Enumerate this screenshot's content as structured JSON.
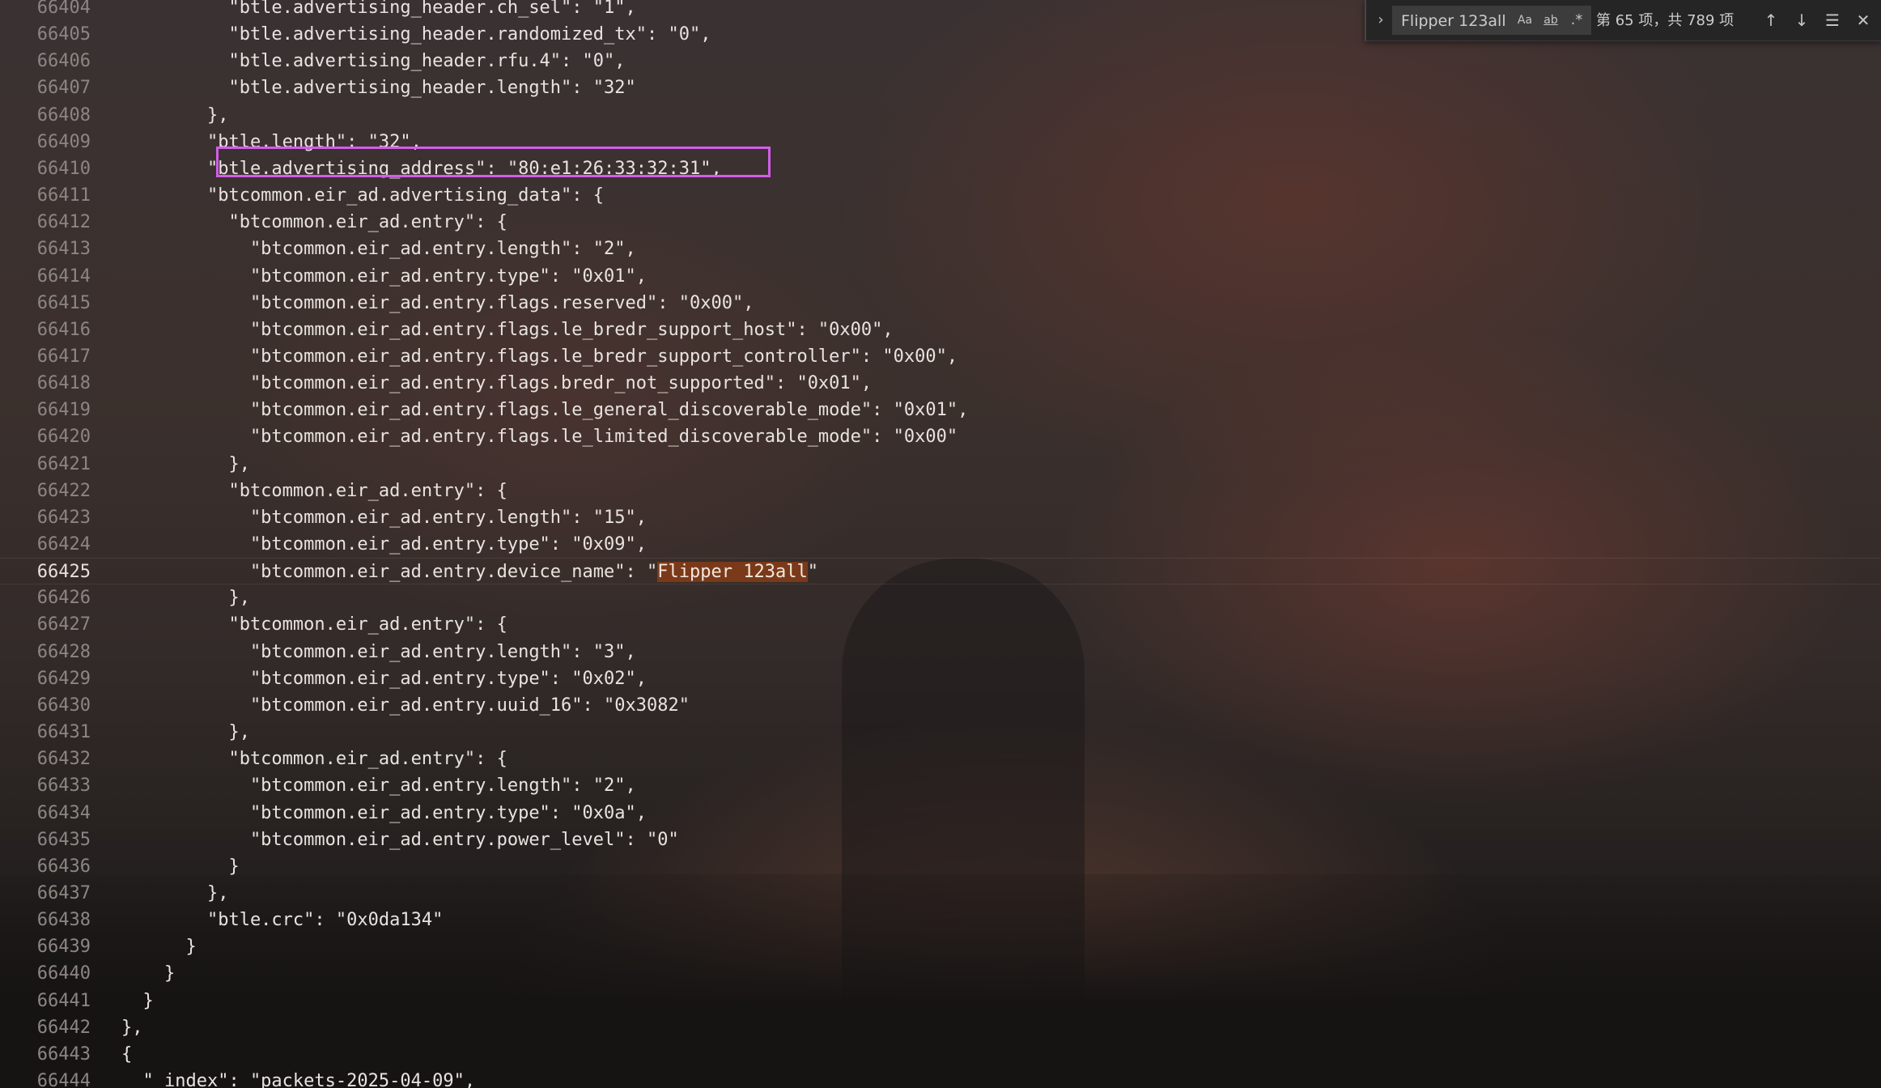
{
  "find_widget": {
    "toggle_icon": "chevron-right-icon",
    "query": "Flipper 123all",
    "options": {
      "match_case": "Aa",
      "whole_word": "ab",
      "regex": ".*"
    },
    "result_count": "第 65 项，共 789 项",
    "buttons": [
      "arrow-up-icon",
      "arrow-down-icon",
      "find-in-selection-icon",
      "close-icon"
    ]
  },
  "editor": {
    "current_line": "66425",
    "highlighted_line": "66410",
    "search_match": "Flipper 123all",
    "lines": [
      {
        "num": "66404",
        "text": "          \"btle.advertising_header.ch_sel\": \"1\","
      },
      {
        "num": "66405",
        "text": "          \"btle.advertising_header.randomized_tx\": \"0\","
      },
      {
        "num": "66406",
        "text": "          \"btle.advertising_header.rfu.4\": \"0\","
      },
      {
        "num": "66407",
        "text": "          \"btle.advertising_header.length\": \"32\""
      },
      {
        "num": "66408",
        "text": "        },"
      },
      {
        "num": "66409",
        "text": "        \"btle.length\": \"32\","
      },
      {
        "num": "66410",
        "text": "        \"btle.advertising_address\": \"80:e1:26:33:32:31\","
      },
      {
        "num": "66411",
        "text": "        \"btcommon.eir_ad.advertising_data\": {"
      },
      {
        "num": "66412",
        "text": "          \"btcommon.eir_ad.entry\": {"
      },
      {
        "num": "66413",
        "text": "            \"btcommon.eir_ad.entry.length\": \"2\","
      },
      {
        "num": "66414",
        "text": "            \"btcommon.eir_ad.entry.type\": \"0x01\","
      },
      {
        "num": "66415",
        "text": "            \"btcommon.eir_ad.entry.flags.reserved\": \"0x00\","
      },
      {
        "num": "66416",
        "text": "            \"btcommon.eir_ad.entry.flags.le_bredr_support_host\": \"0x00\","
      },
      {
        "num": "66417",
        "text": "            \"btcommon.eir_ad.entry.flags.le_bredr_support_controller\": \"0x00\","
      },
      {
        "num": "66418",
        "text": "            \"btcommon.eir_ad.entry.flags.bredr_not_supported\": \"0x01\","
      },
      {
        "num": "66419",
        "text": "            \"btcommon.eir_ad.entry.flags.le_general_discoverable_mode\": \"0x01\","
      },
      {
        "num": "66420",
        "text": "            \"btcommon.eir_ad.entry.flags.le_limited_discoverable_mode\": \"0x00\""
      },
      {
        "num": "66421",
        "text": "          },"
      },
      {
        "num": "66422",
        "text": "          \"btcommon.eir_ad.entry\": {"
      },
      {
        "num": "66423",
        "text": "            \"btcommon.eir_ad.entry.length\": \"15\","
      },
      {
        "num": "66424",
        "text": "            \"btcommon.eir_ad.entry.type\": \"0x09\","
      },
      {
        "num": "66425",
        "text": "            \"btcommon.eir_ad.entry.device_name\": \"Flipper 123all\""
      },
      {
        "num": "66426",
        "text": "          },"
      },
      {
        "num": "66427",
        "text": "          \"btcommon.eir_ad.entry\": {"
      },
      {
        "num": "66428",
        "text": "            \"btcommon.eir_ad.entry.length\": \"3\","
      },
      {
        "num": "66429",
        "text": "            \"btcommon.eir_ad.entry.type\": \"0x02\","
      },
      {
        "num": "66430",
        "text": "            \"btcommon.eir_ad.entry.uuid_16\": \"0x3082\""
      },
      {
        "num": "66431",
        "text": "          },"
      },
      {
        "num": "66432",
        "text": "          \"btcommon.eir_ad.entry\": {"
      },
      {
        "num": "66433",
        "text": "            \"btcommon.eir_ad.entry.length\": \"2\","
      },
      {
        "num": "66434",
        "text": "            \"btcommon.eir_ad.entry.type\": \"0x0a\","
      },
      {
        "num": "66435",
        "text": "            \"btcommon.eir_ad.entry.power_level\": \"0\""
      },
      {
        "num": "66436",
        "text": "          }"
      },
      {
        "num": "66437",
        "text": "        },"
      },
      {
        "num": "66438",
        "text": "        \"btle.crc\": \"0x0da134\""
      },
      {
        "num": "66439",
        "text": "      }"
      },
      {
        "num": "66440",
        "text": "    }"
      },
      {
        "num": "66441",
        "text": "  }"
      },
      {
        "num": "66442",
        "text": "},"
      },
      {
        "num": "66443",
        "text": "{"
      },
      {
        "num": "66444",
        "text": "  \"_index\": \"packets-2025-04-09\","
      }
    ]
  },
  "colors": {
    "highlight_box": "#d25de8",
    "match_background": "#7a3a1a"
  }
}
